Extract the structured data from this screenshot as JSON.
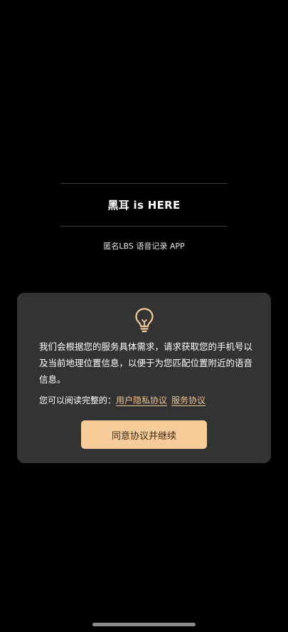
{
  "header": {
    "app_title": "黑耳 is HERE",
    "subtitle": "匿名LBS 语音记录 APP"
  },
  "dialog": {
    "icon": "lightbulb-icon",
    "body_text": "我们会根据您的服务具体需求，请求获取您的手机号以及当前地理位置信息，以便于为您匹配位置附近的语音信息。",
    "agreement_prefix": "您可以阅读完整的：",
    "privacy_link": "用户隐私协议",
    "service_link": "服务协议",
    "agree_button": "同意协议并继续"
  },
  "colors": {
    "background": "#000000",
    "dialog_background": "#333333",
    "accent": "#f8cc98",
    "link": "#f0c08c"
  }
}
